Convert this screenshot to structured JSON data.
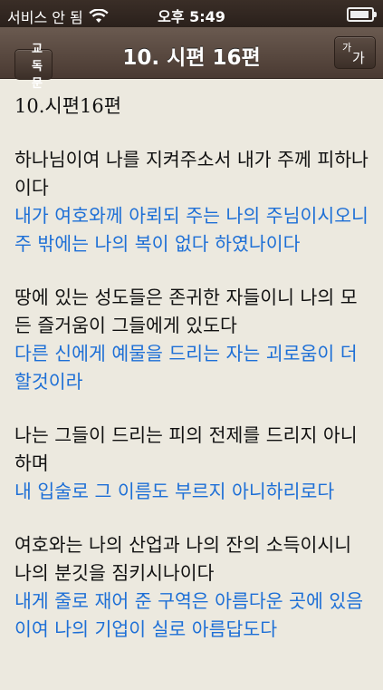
{
  "status": {
    "carrier": "서비스 안 됨",
    "time": "오후 5:49"
  },
  "nav": {
    "back_label": "교독문",
    "title": "10. 시편 16편",
    "font_small": "가",
    "font_big": "가"
  },
  "content": {
    "heading": "10.시편16편",
    "verses": [
      {
        "main": "하나님이여 나를 지켜주소서 내가 주께 피하나이다",
        "sub": "내가 여호와께 아뢰되 주는 나의 주님이시오니 주 밖에는 나의 복이 없다 하였나이다"
      },
      {
        "main": "땅에 있는 성도들은 존귀한 자들이니 나의 모든 즐거움이 그들에게 있도다",
        "sub": "다른 신에게 예물을 드리는 자는 괴로움이 더 할것이라"
      },
      {
        "main": "나는 그들이 드리는 피의 전제를 드리지 아니하며",
        "sub": "내 입술로 그 이름도 부르지 아니하리로다"
      },
      {
        "main": "여호와는 나의 산업과 나의 잔의 소득이시니 나의 분깃을 짐키시나이다",
        "sub": "내게 줄로 재어 준 구역은 아름다운 곳에 있음이여 나의 기업이 실로 아름답도다"
      }
    ]
  }
}
